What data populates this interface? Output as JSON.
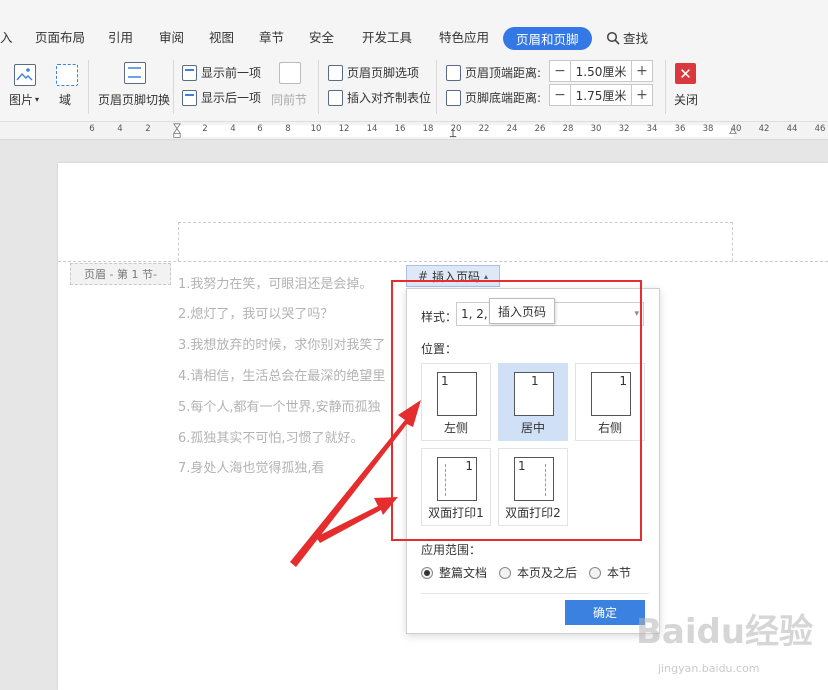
{
  "tabs": [
    {
      "label": "入",
      "active": false
    },
    {
      "label": "页面布局",
      "active": false
    },
    {
      "label": "引用",
      "active": false
    },
    {
      "label": "审阅",
      "active": false
    },
    {
      "label": "视图",
      "active": false
    },
    {
      "label": "章节",
      "active": false
    },
    {
      "label": "安全",
      "active": false
    },
    {
      "label": "开发工具",
      "active": false
    },
    {
      "label": "特色应用",
      "active": false
    },
    {
      "label": "页眉和页脚",
      "active": true
    }
  ],
  "search_label": "查找",
  "ribbon": {
    "picture": "图片",
    "field": "域",
    "switch_header_footer": "页眉页脚切换",
    "show_prev": "显示前一项",
    "show_next": "显示后一项",
    "same_as_prev": "同前节",
    "header_footer_options": "页眉页脚选项",
    "insert_align_tab": "插入对齐制表位",
    "header_top_label": "页眉顶端距离:",
    "header_top_value": "1.50厘米",
    "footer_bottom_label": "页脚底端距离:",
    "footer_bottom_value": "1.75厘米",
    "close": "关闭"
  },
  "ruler_numbers": [
    "6",
    "4",
    "2",
    "2",
    "4",
    "6",
    "8",
    "10",
    "12",
    "14",
    "16",
    "18",
    "20",
    "22",
    "24",
    "26",
    "28",
    "30",
    "32",
    "34",
    "36",
    "38",
    "40",
    "42",
    "44",
    "46"
  ],
  "document": {
    "header_label": "页眉 - 第 1 节-",
    "lines": [
      "1.我努力在笑，可眼泪还是会掉。",
      "2.熄灯了，我可以哭了吗？",
      "3.我想放弃的时候，求你别对我笑了",
      "4.请相信，生活总会在最深的绝望里",
      "5.每个人,都有一个世界,安静而孤独",
      "6.孤独其实不可怕,习惯了就好。",
      "7.身处人海也觉得孤独,看"
    ]
  },
  "insert_page_number": {
    "tab_label": "插入页码",
    "style_label": "样式：",
    "style_value": "1, 2, 3",
    "tooltip": "插入页码",
    "position_label": "位置：",
    "positions": [
      {
        "label": "左侧",
        "num": "1",
        "selected": false
      },
      {
        "label": "居中",
        "num": "1",
        "selected": true
      },
      {
        "label": "右侧",
        "num": "1",
        "selected": false
      },
      {
        "label": "双面打印1",
        "num": "1",
        "selected": false
      },
      {
        "label": "双面打印2",
        "num": "1",
        "selected": false
      }
    ],
    "scope_label": "应用范围：",
    "scope_options": [
      {
        "label": "整篇文档",
        "checked": true
      },
      {
        "label": "本页及之后",
        "checked": false
      },
      {
        "label": "本节",
        "checked": false
      }
    ],
    "ok_button": "确定"
  },
  "watermark": {
    "main": "Baidu经验",
    "sub": "jingyan.baidu.com"
  },
  "colors": {
    "accent": "#3478e5",
    "annotation": "#e52d2d",
    "close": "#d9393e"
  }
}
